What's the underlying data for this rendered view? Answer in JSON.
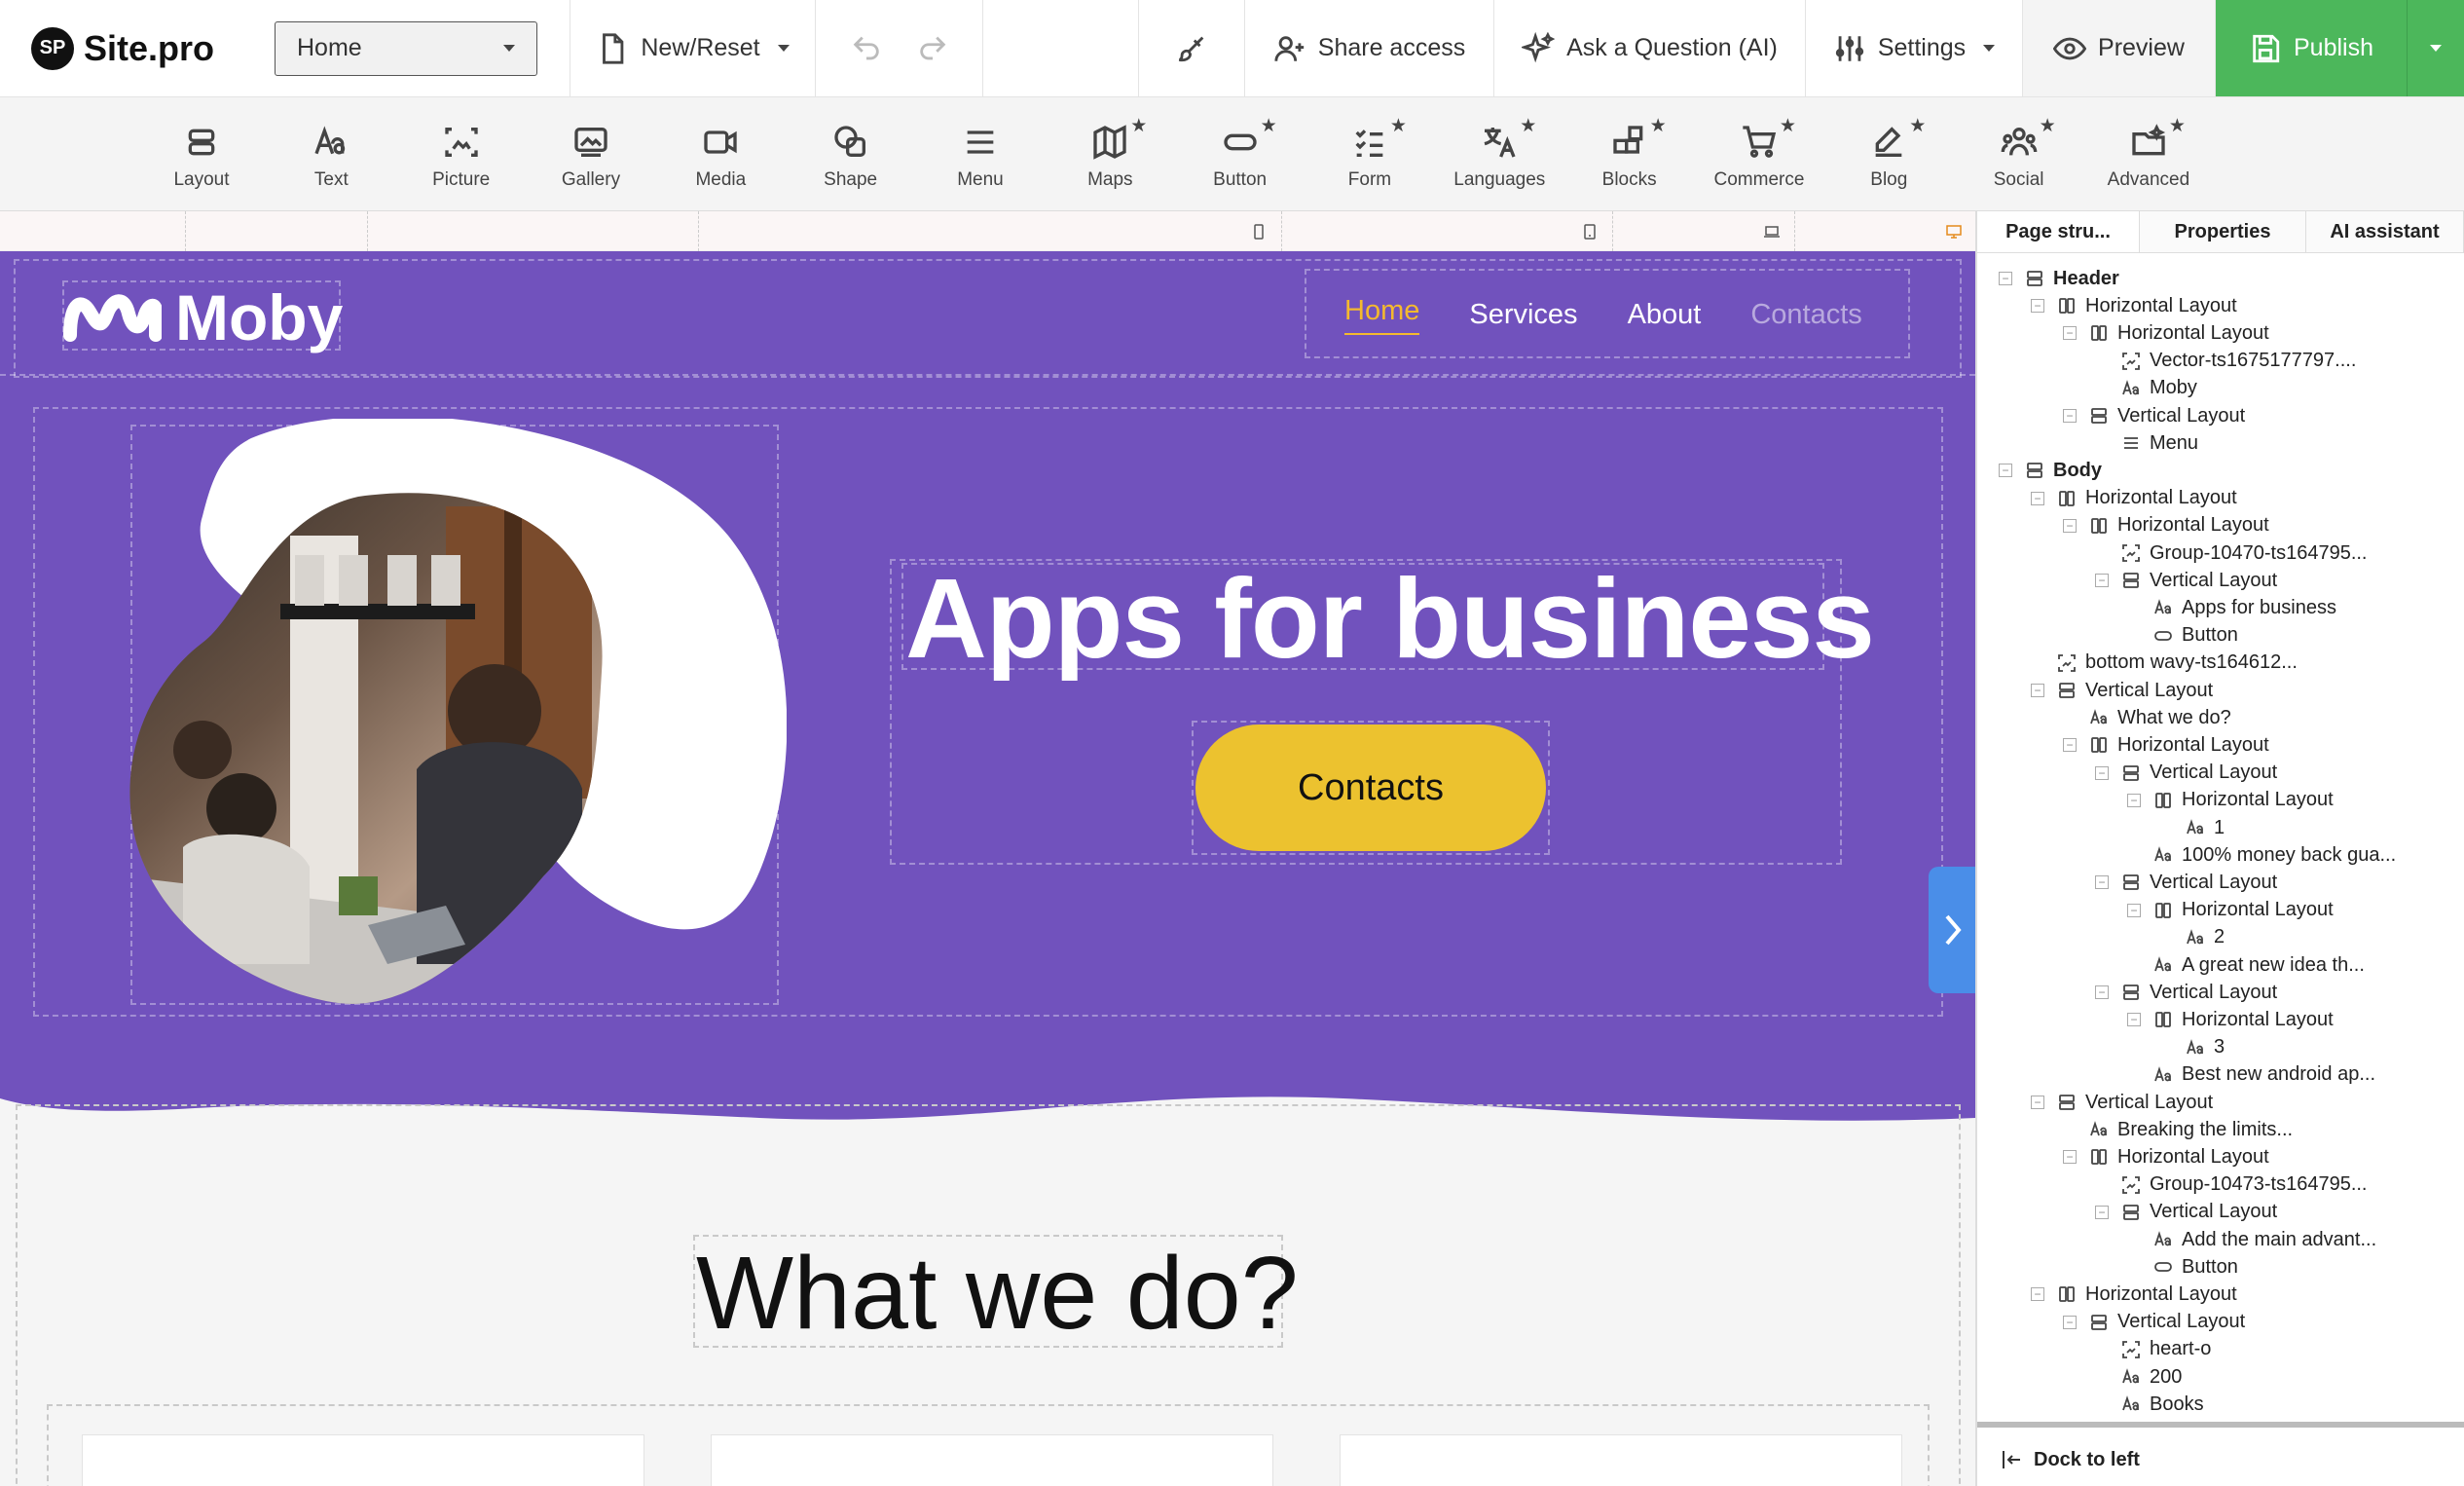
{
  "app": {
    "logo_badge": "SP",
    "logo_text": "Site.pro"
  },
  "topbar": {
    "page_select": "Home",
    "new_reset": "New/Reset",
    "share_access": "Share access",
    "ask_question": "Ask a Question (AI)",
    "settings": "Settings",
    "preview": "Preview",
    "publish": "Publish"
  },
  "tools": [
    {
      "label": "Layout",
      "premium": false
    },
    {
      "label": "Text",
      "premium": false
    },
    {
      "label": "Picture",
      "premium": false
    },
    {
      "label": "Gallery",
      "premium": false
    },
    {
      "label": "Media",
      "premium": false
    },
    {
      "label": "Shape",
      "premium": false
    },
    {
      "label": "Menu",
      "premium": false
    },
    {
      "label": "Maps",
      "premium": true
    },
    {
      "label": "Button",
      "premium": true
    },
    {
      "label": "Form",
      "premium": true
    },
    {
      "label": "Languages",
      "premium": true
    },
    {
      "label": "Blocks",
      "premium": true
    },
    {
      "label": "Commerce",
      "premium": true
    },
    {
      "label": "Blog",
      "premium": true
    },
    {
      "label": "Social",
      "premium": true
    },
    {
      "label": "Advanced",
      "premium": true
    }
  ],
  "site": {
    "brand": "Moby",
    "nav": [
      "Home",
      "Services",
      "About",
      "Contacts"
    ],
    "headline": "Apps for business",
    "cta": "Contacts",
    "section_title": "What we do?"
  },
  "panel": {
    "tabs": [
      "Page stru...",
      "Properties",
      "AI assistant"
    ],
    "dock": "Dock to left",
    "tree": [
      {
        "label": "Header",
        "bold": true,
        "icon": "vlayout",
        "toggle": true,
        "depth": 0
      },
      {
        "label": "Horizontal Layout",
        "icon": "hlayout",
        "toggle": true,
        "depth": 1
      },
      {
        "label": "Horizontal Layout",
        "icon": "hlayout",
        "toggle": true,
        "depth": 2
      },
      {
        "label": "Vector-ts1675177797....",
        "icon": "picture",
        "toggle": false,
        "depth": 3
      },
      {
        "label": "Moby",
        "icon": "text",
        "toggle": false,
        "depth": 3
      },
      {
        "label": "Vertical Layout",
        "icon": "vlayout",
        "toggle": true,
        "depth": 2
      },
      {
        "label": "Menu",
        "icon": "menu",
        "toggle": false,
        "depth": 3
      },
      {
        "label": "Body",
        "bold": true,
        "icon": "vlayout",
        "toggle": true,
        "depth": 0
      },
      {
        "label": "Horizontal Layout",
        "icon": "hlayout",
        "toggle": true,
        "depth": 1
      },
      {
        "label": "Horizontal Layout",
        "icon": "hlayout",
        "toggle": true,
        "depth": 2
      },
      {
        "label": "Group-10470-ts164795...",
        "icon": "picture",
        "toggle": false,
        "depth": 3
      },
      {
        "label": "Vertical Layout",
        "icon": "vlayout",
        "toggle": true,
        "depth": 3
      },
      {
        "label": "Apps for business",
        "icon": "text",
        "toggle": false,
        "depth": 4
      },
      {
        "label": "Button",
        "icon": "button",
        "toggle": false,
        "depth": 4
      },
      {
        "label": "bottom wavy-ts164612...",
        "icon": "picture",
        "toggle": false,
        "depth": 1
      },
      {
        "label": "Vertical Layout",
        "icon": "vlayout",
        "toggle": true,
        "depth": 1
      },
      {
        "label": "What we do?",
        "icon": "text",
        "toggle": false,
        "depth": 2
      },
      {
        "label": "Horizontal Layout",
        "icon": "hlayout",
        "toggle": true,
        "depth": 2
      },
      {
        "label": "Vertical Layout",
        "icon": "vlayout",
        "toggle": true,
        "depth": 3
      },
      {
        "label": "Horizontal Layout",
        "icon": "hlayout",
        "toggle": true,
        "depth": 4
      },
      {
        "label": "1",
        "icon": "text",
        "toggle": false,
        "depth": 5
      },
      {
        "label": "100% money back gua...",
        "icon": "text",
        "toggle": false,
        "depth": 4
      },
      {
        "label": "Vertical Layout",
        "icon": "vlayout",
        "toggle": true,
        "depth": 3
      },
      {
        "label": "Horizontal Layout",
        "icon": "hlayout",
        "toggle": true,
        "depth": 4
      },
      {
        "label": "2",
        "icon": "text",
        "toggle": false,
        "depth": 5
      },
      {
        "label": "A great new idea th...",
        "icon": "text",
        "toggle": false,
        "depth": 4
      },
      {
        "label": "Vertical Layout",
        "icon": "vlayout",
        "toggle": true,
        "depth": 3
      },
      {
        "label": "Horizontal Layout",
        "icon": "hlayout",
        "toggle": true,
        "depth": 4
      },
      {
        "label": "3",
        "icon": "text",
        "toggle": false,
        "depth": 5
      },
      {
        "label": "Best new android ap...",
        "icon": "text",
        "toggle": false,
        "depth": 4
      },
      {
        "label": "Vertical Layout",
        "icon": "vlayout",
        "toggle": true,
        "depth": 1
      },
      {
        "label": "Breaking the limits...",
        "icon": "text",
        "toggle": false,
        "depth": 2
      },
      {
        "label": "Horizontal Layout",
        "icon": "hlayout",
        "toggle": true,
        "depth": 2
      },
      {
        "label": "Group-10473-ts164795...",
        "icon": "picture",
        "toggle": false,
        "depth": 3
      },
      {
        "label": "Vertical Layout",
        "icon": "vlayout",
        "toggle": true,
        "depth": 3
      },
      {
        "label": "Add the main advant...",
        "icon": "text",
        "toggle": false,
        "depth": 4
      },
      {
        "label": "Button",
        "icon": "button",
        "toggle": false,
        "depth": 4
      },
      {
        "label": "Horizontal Layout",
        "icon": "hlayout",
        "toggle": true,
        "depth": 1
      },
      {
        "label": "Vertical Layout",
        "icon": "vlayout",
        "toggle": true,
        "depth": 2
      },
      {
        "label": "heart-o",
        "icon": "picture",
        "toggle": false,
        "depth": 3
      },
      {
        "label": "200",
        "icon": "text",
        "toggle": false,
        "depth": 3
      },
      {
        "label": "Books",
        "icon": "text",
        "toggle": false,
        "depth": 3
      }
    ]
  },
  "colors": {
    "hero_bg": "#7152bd",
    "accent": "#ecc22f",
    "publish": "#4cb75b",
    "star": "#f07a12"
  }
}
